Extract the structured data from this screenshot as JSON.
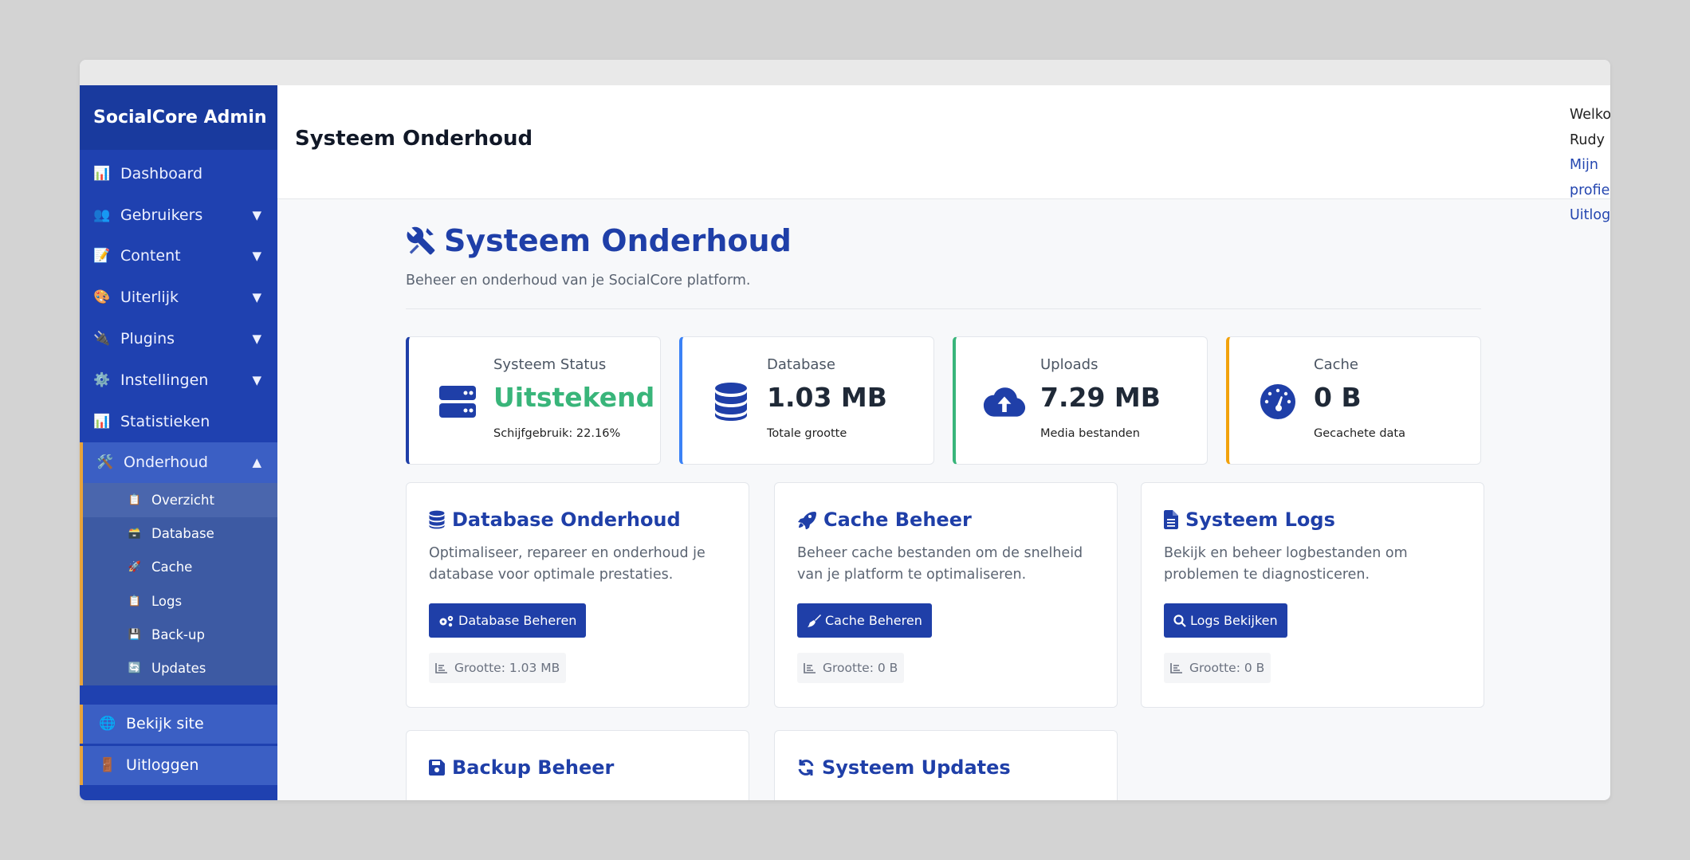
{
  "app": {
    "brand": "SocialCore Admin"
  },
  "sidebar": {
    "items": [
      {
        "label": "Dashboard",
        "icon": "📊",
        "caret": ""
      },
      {
        "label": "Gebruikers",
        "icon": "👥",
        "caret": "▼"
      },
      {
        "label": "Content",
        "icon": "📝",
        "caret": "▼"
      },
      {
        "label": "Uiterlijk",
        "icon": "🎨",
        "caret": "▼"
      },
      {
        "label": "Plugins",
        "icon": "🔌",
        "caret": "▼"
      },
      {
        "label": "Instellingen",
        "icon": "⚙️",
        "caret": "▼"
      },
      {
        "label": "Statistieken",
        "icon": "📊",
        "caret": ""
      },
      {
        "label": "Onderhoud",
        "icon": "🛠️",
        "caret": "▲"
      }
    ],
    "subitems": [
      {
        "label": "Overzicht",
        "icon": "📋"
      },
      {
        "label": "Database",
        "icon": "🗃️"
      },
      {
        "label": "Cache",
        "icon": "🚀"
      },
      {
        "label": "Logs",
        "icon": "📋"
      },
      {
        "label": "Back-up",
        "icon": "💾"
      },
      {
        "label": "Updates",
        "icon": "🔄"
      }
    ],
    "bottom": [
      {
        "label": "Bekijk site",
        "icon": "🌐"
      },
      {
        "label": "Uitloggen",
        "icon": "🚪"
      }
    ]
  },
  "header": {
    "title": "Systeem Onderhoud",
    "welcome": "Welkom, Rudy",
    "profile_link": "Mijn profiel",
    "logout_link": "Uitloggen"
  },
  "page": {
    "title": "Systeem Onderhoud",
    "subtitle": "Beheer en onderhoud van je SocialCore platform."
  },
  "stats": [
    {
      "label": "Systeem Status",
      "value": "Uitstekend",
      "sub": "Schijfgebruik: 22.16%",
      "icon": "server-icon"
    },
    {
      "label": "Database",
      "value": "1.03 MB",
      "sub": "Totale grootte",
      "icon": "database-icon"
    },
    {
      "label": "Uploads",
      "value": "7.29 MB",
      "sub": "Media bestanden",
      "icon": "cloud-upload-icon"
    },
    {
      "label": "Cache",
      "value": "0 B",
      "sub": "Gecachete data",
      "icon": "gauge-icon"
    }
  ],
  "cards": [
    {
      "title": "Database Onderhoud",
      "desc": "Optimaliseer, repareer en onderhoud je database voor optimale prestaties.",
      "button": "Database Beheren",
      "meta": "Grootte: 1.03 MB"
    },
    {
      "title": "Cache Beheer",
      "desc": "Beheer cache bestanden om de snelheid van je platform te optimaliseren.",
      "button": "Cache Beheren",
      "meta": "Grootte: 0 B"
    },
    {
      "title": "Systeem Logs",
      "desc": "Bekijk en beheer logbestanden om problemen te diagnosticeren.",
      "button": "Logs Bekijken",
      "meta": "Grootte: 0 B"
    },
    {
      "title": "Backup Beheer"
    },
    {
      "title": "Systeem Updates"
    }
  ],
  "colors": {
    "primary": "#1f3fa8",
    "sidebar": "#1f41b0",
    "accent": "#e8a33a",
    "status_green": "#39b57a",
    "border_db": "#3b82f6",
    "border_uploads": "#39b57a",
    "border_cache": "#f2a20c"
  }
}
